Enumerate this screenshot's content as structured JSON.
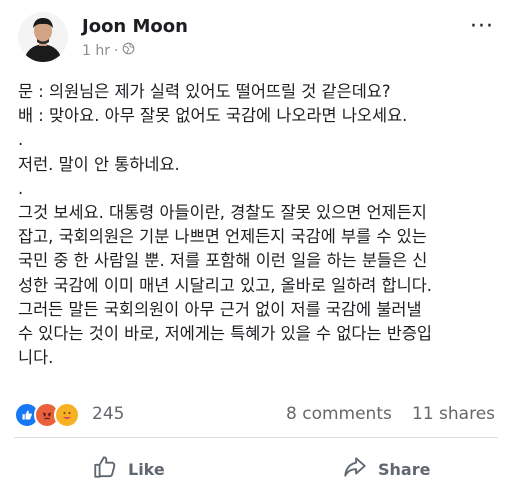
{
  "post": {
    "author": "Joon Moon",
    "time": "1 hr",
    "separator": "·",
    "more": "···",
    "lines": [
      "문 : 의원님은 제가 실력 있어도 떨어뜨릴 것 같은데요?",
      "배 : 맞아요. 아무 잘못 없어도 국감에 나오라면 나오세요.",
      ".",
      "저런. 말이 안 통하네요.",
      ".",
      "그것 보세요. 대통령 아들이란, 경찰도 잘못 있으면 언제든지",
      "잡고, 국회의원은 기분 나쁘면 언제든지 국감에 부를 수 있는",
      "국민 중 한 사람일 뿐. 저를 포함해 이런 일을 하는 분들은 신",
      "성한 국감에 이미 매년 시달리고 있고, 올바로 일하려 합니다.",
      "그러든 말든 국회의원이 아무 근거 없이 저를 국감에 불러낼",
      "수 있다는 것이 바로, 저에게는 특혜가 있을 수 없다는 반증입",
      "니다."
    ]
  },
  "stats": {
    "reaction_count": "245",
    "comments": "8 comments",
    "shares": "11 shares",
    "reaction_icons": [
      "like-icon",
      "angry-icon",
      "care-icon"
    ]
  },
  "actions": {
    "like": "Like",
    "share": "Share"
  },
  "colors": {
    "like_blue": "#1877f2",
    "angry": "#e8603c",
    "care": "#f7b125",
    "muted": "#65676b"
  }
}
